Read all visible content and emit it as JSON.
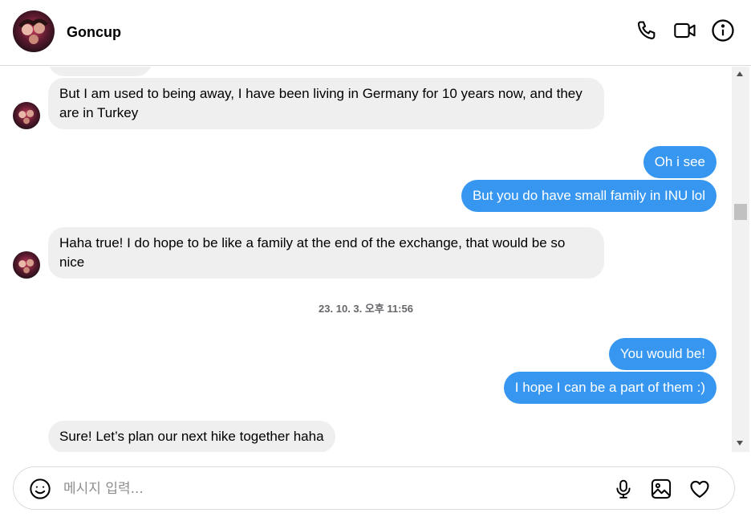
{
  "header": {
    "name": "Goncup",
    "icons": [
      "phone-icon",
      "video-camera-icon",
      "info-icon"
    ]
  },
  "messages": [
    {
      "direction": "incoming",
      "text": "But I am used to being away, I have been living in Germany for 10 years now, and they are in Turkey"
    },
    {
      "direction": "outgoing",
      "text": "Oh i see"
    },
    {
      "direction": "outgoing",
      "text": "But you do have small family in INU lol"
    },
    {
      "direction": "incoming",
      "text": "Haha true! I do hope to be like a family at the end of the exchange, that would be so nice"
    },
    {
      "direction": "outgoing",
      "text": "You would be!"
    },
    {
      "direction": "outgoing",
      "text": "I hope I can be a part of them :)"
    },
    {
      "direction": "incoming",
      "text": "Sure! Let’s plan our next hike together haha"
    }
  ],
  "timestamp": "23. 10. 3. 오후 11:56",
  "composer": {
    "placeholder": "메시지 입력...",
    "icons": [
      "emoji-icon",
      "microphone-icon",
      "image-icon",
      "heart-icon"
    ]
  },
  "colors": {
    "outgoing_bubble": "#3797f0",
    "incoming_bubble": "#efefef"
  }
}
